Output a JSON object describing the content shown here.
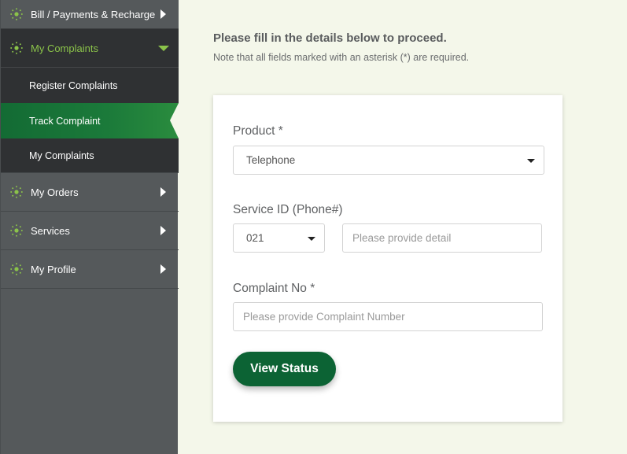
{
  "sidebar": {
    "items": [
      {
        "label": "Bill / Payments & Recharge",
        "icon": "dotted-circle-icon",
        "state": "collapsed"
      },
      {
        "label": "My Complaints",
        "icon": "dotted-circle-icon",
        "state": "expanded",
        "children": [
          {
            "label": "Register Complaints",
            "active": false
          },
          {
            "label": "Track Complaint",
            "active": true
          },
          {
            "label": "My Complaints",
            "active": false
          }
        ]
      },
      {
        "label": "My Orders",
        "icon": "dotted-circle-icon",
        "state": "collapsed"
      },
      {
        "label": "Services",
        "icon": "dotted-circle-icon",
        "state": "collapsed"
      },
      {
        "label": "My Profile",
        "icon": "dotted-circle-icon",
        "state": "collapsed"
      }
    ]
  },
  "intro": {
    "title": "Please fill in the details below to proceed.",
    "note": "Note that all fields marked with an asterisk (*) are required."
  },
  "form": {
    "product": {
      "label": "Product *",
      "value": "Telephone"
    },
    "service_id": {
      "label": "Service ID (Phone#)",
      "area_code": "021",
      "placeholder": "Please provide detail"
    },
    "complaint_no": {
      "label": "Complaint No *",
      "placeholder": "Please provide Complaint Number"
    },
    "submit_label": "View Status"
  },
  "colors": {
    "accent_green": "#8bc34a",
    "button_green": "#0c6334",
    "active_item": "#1b7a3a",
    "sidebar": "#55595b",
    "background": "#f4f7ea"
  }
}
